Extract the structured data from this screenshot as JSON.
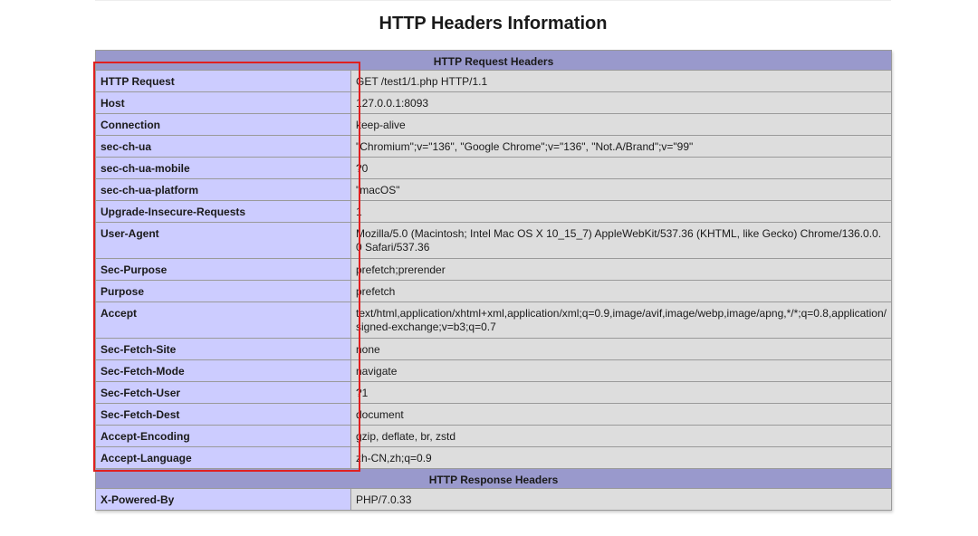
{
  "page": {
    "title": "HTTP Headers Information"
  },
  "request_section": {
    "header": "HTTP Request Headers",
    "rows": [
      {
        "key": "HTTP Request",
        "value": "GET /test1/1.php HTTP/1.1"
      },
      {
        "key": "Host",
        "value": "127.0.0.1:8093"
      },
      {
        "key": "Connection",
        "value": "keep-alive"
      },
      {
        "key": "sec-ch-ua",
        "value": "\"Chromium\";v=\"136\", \"Google Chrome\";v=\"136\", \"Not.A/Brand\";v=\"99\""
      },
      {
        "key": "sec-ch-ua-mobile",
        "value": "?0"
      },
      {
        "key": "sec-ch-ua-platform",
        "value": "\"macOS\""
      },
      {
        "key": "Upgrade-Insecure-Requests",
        "value": "1"
      },
      {
        "key": "User-Agent",
        "value": "Mozilla/5.0 (Macintosh; Intel Mac OS X 10_15_7) AppleWebKit/537.36 (KHTML, like Gecko) Chrome/136.0.0.0 Safari/537.36"
      },
      {
        "key": "Sec-Purpose",
        "value": "prefetch;prerender"
      },
      {
        "key": "Purpose",
        "value": "prefetch"
      },
      {
        "key": "Accept",
        "value": "text/html,application/xhtml+xml,application/xml;q=0.9,image/avif,image/webp,image/apng,*/*;q=0.8,application/signed-exchange;v=b3;q=0.7"
      },
      {
        "key": "Sec-Fetch-Site",
        "value": "none"
      },
      {
        "key": "Sec-Fetch-Mode",
        "value": "navigate"
      },
      {
        "key": "Sec-Fetch-User",
        "value": "?1"
      },
      {
        "key": "Sec-Fetch-Dest",
        "value": "document"
      },
      {
        "key": "Accept-Encoding",
        "value": "gzip, deflate, br, zstd"
      },
      {
        "key": "Accept-Language",
        "value": "zh-CN,zh;q=0.9"
      }
    ]
  },
  "response_section": {
    "header": "HTTP Response Headers",
    "rows": [
      {
        "key": "X-Powered-By",
        "value": "PHP/7.0.33"
      }
    ]
  },
  "colors": {
    "section_header_bg": "#9999cc",
    "key_cell_bg": "#ccccff",
    "value_cell_bg": "#dddddd",
    "highlight_border": "#e02020"
  }
}
